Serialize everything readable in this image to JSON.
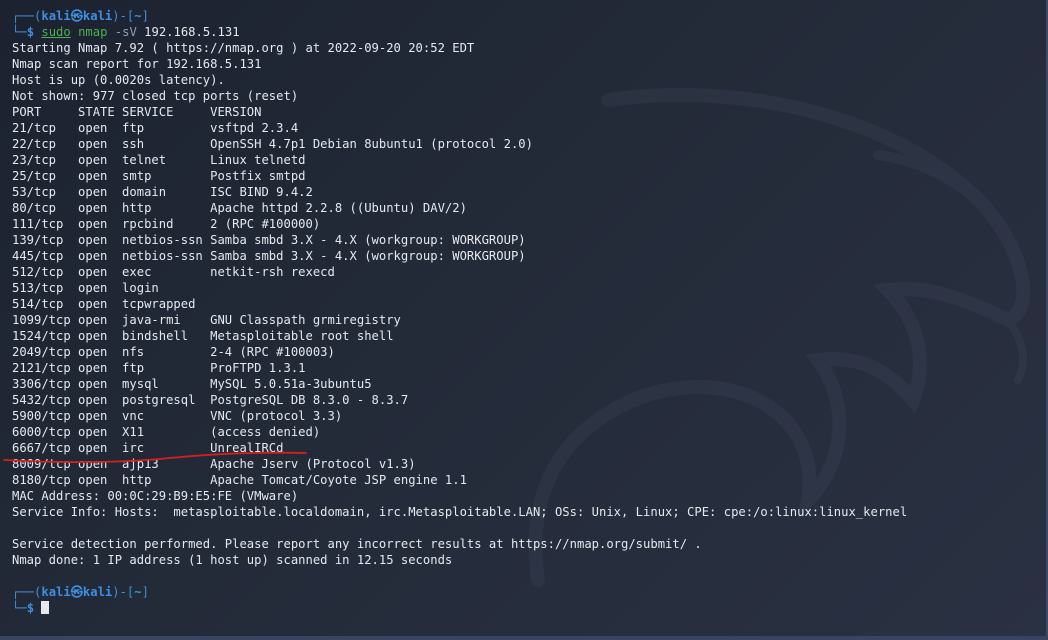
{
  "prompt1": {
    "open": "┌──(",
    "user": "kali㉿kali",
    "close": ")-[",
    "dir": "~",
    "end": "]"
  },
  "command": {
    "prefix": "└─",
    "dollar": "$",
    "sudo": "sudo",
    "nmap": "nmap",
    "flag": "-sV",
    "target": "192.168.5.131"
  },
  "output": {
    "header": [
      "Starting Nmap 7.92 ( https://nmap.org ) at 2022-09-20 20:52 EDT",
      "Nmap scan report for 192.168.5.131",
      "Host is up (0.0020s latency).",
      "Not shown: 977 closed tcp ports (reset)",
      "PORT     STATE SERVICE     VERSION"
    ],
    "ports": [
      "21/tcp   open  ftp         vsftpd 2.3.4",
      "22/tcp   open  ssh         OpenSSH 4.7p1 Debian 8ubuntu1 (protocol 2.0)",
      "23/tcp   open  telnet      Linux telnetd",
      "25/tcp   open  smtp        Postfix smtpd",
      "53/tcp   open  domain      ISC BIND 9.4.2",
      "80/tcp   open  http        Apache httpd 2.2.8 ((Ubuntu) DAV/2)",
      "111/tcp  open  rpcbind     2 (RPC #100000)",
      "139/tcp  open  netbios-ssn Samba smbd 3.X - 4.X (workgroup: WORKGROUP)",
      "445/tcp  open  netbios-ssn Samba smbd 3.X - 4.X (workgroup: WORKGROUP)",
      "512/tcp  open  exec        netkit-rsh rexecd",
      "513/tcp  open  login",
      "514/tcp  open  tcpwrapped",
      "1099/tcp open  java-rmi    GNU Classpath grmiregistry",
      "1524/tcp open  bindshell   Metasploitable root shell",
      "2049/tcp open  nfs         2-4 (RPC #100003)",
      "2121/tcp open  ftp         ProFTPD 1.3.1",
      "3306/tcp open  mysql       MySQL 5.0.51a-3ubuntu5",
      "5432/tcp open  postgresql  PostgreSQL DB 8.3.0 - 8.3.7",
      "5900/tcp open  vnc         VNC (protocol 3.3)",
      "6000/tcp open  X11         (access denied)",
      "6667/tcp open  irc         UnrealIRCd",
      "8009/tcp open  ajp13       Apache Jserv (Protocol v1.3)",
      "8180/tcp open  http        Apache Tomcat/Coyote JSP engine 1.1"
    ],
    "footer": [
      "MAC Address: 00:0C:29:B9:E5:FE (VMware)",
      "Service Info: Hosts:  metasploitable.localdomain, irc.Metasploitable.LAN; OSs: Unix, Linux; CPE: cpe:/o:linux:linux_kernel"
    ],
    "closing": [
      "Service detection performed. Please report any incorrect results at https://nmap.org/submit/ .",
      "Nmap done: 1 IP address (1 host up) scanned in 12.15 seconds"
    ]
  },
  "prompt2": {
    "open": "┌──(",
    "user": "kali㉿kali",
    "close": ")-[",
    "dir": "~",
    "end": "]",
    "prefix": "└─",
    "dollar": "$"
  },
  "colors": {
    "prompt": "#3f8fe0",
    "command": "#4caf50",
    "text": "#e6e8ee",
    "annotation": "#d62020",
    "background": "#232a38"
  },
  "icons": {
    "background": "kali-dragon-logo",
    "annotation": "red-hand-drawn-underline"
  }
}
